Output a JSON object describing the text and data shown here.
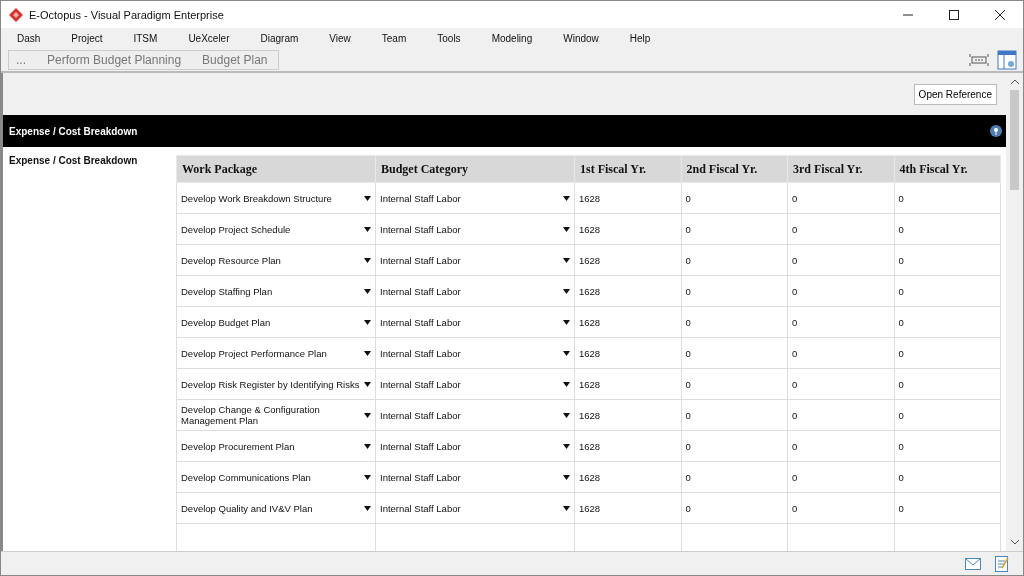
{
  "window": {
    "title": "E-Octopus - Visual Paradigm Enterprise"
  },
  "menu": [
    "Dash",
    "Project",
    "ITSM",
    "UeXceler",
    "Diagram",
    "View",
    "Team",
    "Tools",
    "Modeling",
    "Window",
    "Help"
  ],
  "breadcrumb": [
    "...",
    "Perform Budget Planning",
    "Budget Plan"
  ],
  "open_reference": "Open Reference",
  "section": {
    "title": "Expense / Cost Breakdown",
    "label": "Expense / Cost Breakdown"
  },
  "table": {
    "columns": [
      "Work Package",
      "Budget Category",
      "1st Fiscal Yr.",
      "2nd Fiscal Yr.",
      "3rd Fiscal Yr.",
      "4th Fiscal Yr."
    ],
    "rows": [
      {
        "work_package": "Develop Work Breakdown Structure",
        "budget_category": "Internal Staff Labor",
        "values": [
          "1628",
          "0",
          "0",
          "0"
        ]
      },
      {
        "work_package": "Develop Project Schedule",
        "budget_category": "Internal Staff Labor",
        "values": [
          "1628",
          "0",
          "0",
          "0"
        ]
      },
      {
        "work_package": "Develop Resource Plan",
        "budget_category": "Internal Staff Labor",
        "values": [
          "1628",
          "0",
          "0",
          "0"
        ]
      },
      {
        "work_package": "Develop Staffing Plan",
        "budget_category": "Internal Staff Labor",
        "values": [
          "1628",
          "0",
          "0",
          "0"
        ]
      },
      {
        "work_package": "Develop Budget Plan",
        "budget_category": "Internal Staff Labor",
        "values": [
          "1628",
          "0",
          "0",
          "0"
        ]
      },
      {
        "work_package": "Develop Project Performance Plan",
        "budget_category": "Internal Staff Labor",
        "values": [
          "1628",
          "0",
          "0",
          "0"
        ]
      },
      {
        "work_package": "Develop Risk Register by Identifying Risks",
        "budget_category": "Internal Staff Labor",
        "values": [
          "1628",
          "0",
          "0",
          "0"
        ]
      },
      {
        "work_package": "Develop Change & Configuration Management Plan",
        "budget_category": "Internal Staff Labor",
        "values": [
          "1628",
          "0",
          "0",
          "0"
        ]
      },
      {
        "work_package": "Develop Procurement Plan",
        "budget_category": "Internal Staff Labor",
        "values": [
          "1628",
          "0",
          "0",
          "0"
        ]
      },
      {
        "work_package": "Develop Communications Plan",
        "budget_category": "Internal Staff Labor",
        "values": [
          "1628",
          "0",
          "0",
          "0"
        ]
      },
      {
        "work_package": "Develop Quality and IV&V Plan",
        "budget_category": "Internal Staff Labor",
        "values": [
          "1628",
          "0",
          "0",
          "0"
        ]
      }
    ]
  }
}
